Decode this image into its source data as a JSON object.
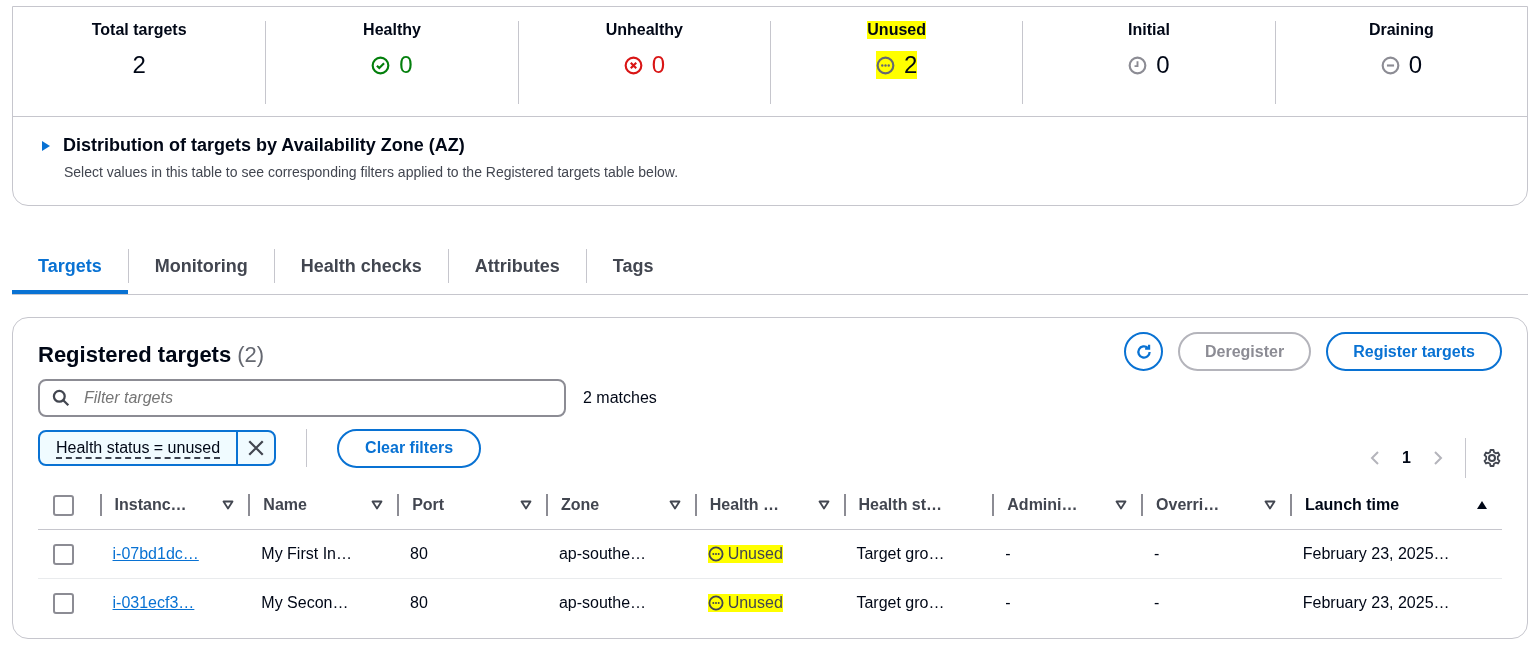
{
  "summary": {
    "stats": [
      {
        "label": "Total targets",
        "value": "2",
        "kind": "plain",
        "highlighted": false
      },
      {
        "label": "Healthy",
        "value": "0",
        "kind": "healthy",
        "highlighted": false
      },
      {
        "label": "Unhealthy",
        "value": "0",
        "kind": "unhealthy",
        "highlighted": false
      },
      {
        "label": "Unused",
        "value": "2",
        "kind": "unused",
        "highlighted": true
      },
      {
        "label": "Initial",
        "value": "0",
        "kind": "initial",
        "highlighted": false
      },
      {
        "label": "Draining",
        "value": "0",
        "kind": "draining",
        "highlighted": false
      }
    ],
    "distribution": {
      "title": "Distribution of targets by Availability Zone (AZ)",
      "description": "Select values in this table to see corresponding filters applied to the Registered targets table below.",
      "expanded": false
    }
  },
  "tabs": [
    {
      "label": "Targets",
      "selected": true
    },
    {
      "label": "Monitoring",
      "selected": false
    },
    {
      "label": "Health checks",
      "selected": false
    },
    {
      "label": "Attributes",
      "selected": false
    },
    {
      "label": "Tags",
      "selected": false
    }
  ],
  "registered": {
    "title": "Registered targets",
    "count": "(2)",
    "buttons": [
      {
        "label": "Deregister",
        "disabled": true
      },
      {
        "label": "Register targets",
        "disabled": false
      }
    ],
    "search": {
      "placeholder": "Filter targets"
    },
    "matches": "2 matches",
    "filter_token": "Health status = unused",
    "clear_label": "Clear filters",
    "page": "1",
    "all_checked": false,
    "columns": [
      {
        "label": "Instanc…",
        "kind": "filter"
      },
      {
        "label": "Name",
        "kind": "filter"
      },
      {
        "label": "Port",
        "kind": "filter"
      },
      {
        "label": "Zone",
        "kind": "filter"
      },
      {
        "label": "Health …",
        "kind": "filter"
      },
      {
        "label": "Health st…",
        "kind": "plain"
      },
      {
        "label": "Admini…",
        "kind": "filter"
      },
      {
        "label": "Overri…",
        "kind": "filter"
      },
      {
        "label": "Launch time",
        "kind": "sorted"
      }
    ],
    "rows": [
      {
        "checked": false,
        "instance": "i-07bd1dc…",
        "name": "My First In…",
        "port": "80",
        "zone": "ap-southe…",
        "health": "Unused",
        "health_highlighted": true,
        "details": "Target gro…",
        "admin": "-",
        "override": "-",
        "launch": "February 23, 2025…"
      },
      {
        "checked": false,
        "instance": "i-031ecf3…",
        "name": "My Secon…",
        "port": "80",
        "zone": "ap-southe…",
        "health": "Unused",
        "health_highlighted": true,
        "details": "Target gro…",
        "admin": "-",
        "override": "-",
        "launch": "February 23, 2025…"
      }
    ]
  }
}
